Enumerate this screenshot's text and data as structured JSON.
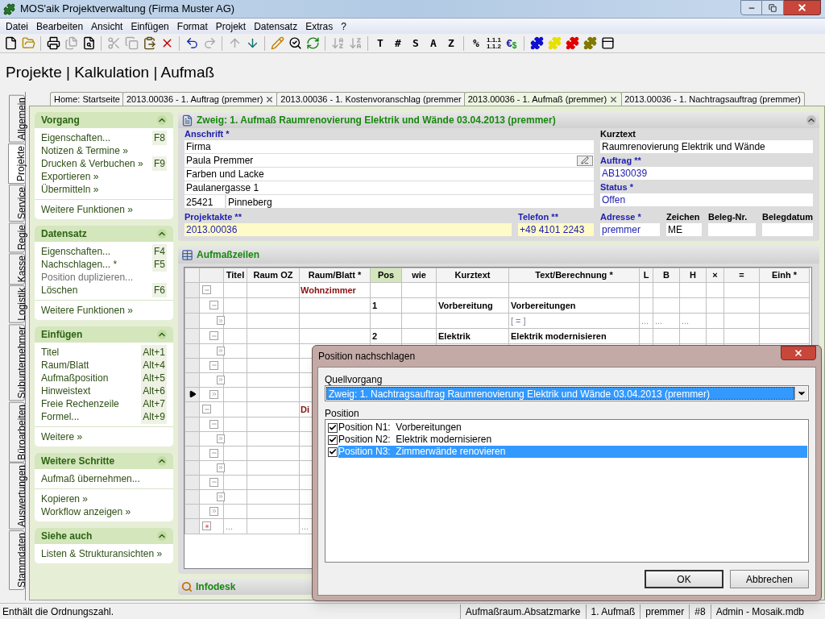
{
  "window": {
    "title": "MOS'aik Projektverwaltung (Firma Muster AG)"
  },
  "menu": [
    "Datei",
    "Bearbeiten",
    "Ansicht",
    "Einfügen",
    "Format",
    "Projekt",
    "Datensatz",
    "Extras",
    "?"
  ],
  "toolbar": [
    {
      "kind": "icon",
      "disabled": false
    },
    {
      "kind": "icon",
      "disabled": false
    },
    {
      "kind": "sep"
    },
    {
      "kind": "icon",
      "disabled": false
    },
    {
      "kind": "icon",
      "disabled": true
    },
    {
      "kind": "icon",
      "disabled": false
    },
    {
      "kind": "sep"
    },
    {
      "kind": "icon",
      "disabled": true
    },
    {
      "kind": "icon",
      "disabled": true
    },
    {
      "kind": "icon",
      "disabled": false
    },
    {
      "kind": "icon",
      "disabled": false
    },
    {
      "kind": "sep"
    },
    {
      "kind": "icon",
      "disabled": false
    },
    {
      "kind": "icon",
      "disabled": true
    },
    {
      "kind": "sep"
    },
    {
      "kind": "icon",
      "disabled": true
    },
    {
      "kind": "icon",
      "disabled": false
    },
    {
      "kind": "sep"
    },
    {
      "kind": "icon",
      "disabled": false
    },
    {
      "kind": "icon",
      "disabled": false
    },
    {
      "kind": "icon",
      "disabled": false
    },
    {
      "kind": "sep"
    },
    {
      "kind": "icon",
      "disabled": true
    },
    {
      "kind": "icon",
      "disabled": true
    },
    {
      "kind": "sep"
    },
    {
      "kind": "text",
      "label": "T",
      "disabled": false
    },
    {
      "kind": "text",
      "label": "#",
      "disabled": false
    },
    {
      "kind": "text",
      "label": "S",
      "disabled": false
    },
    {
      "kind": "text",
      "label": "A",
      "disabled": false
    },
    {
      "kind": "text",
      "label": "Z",
      "disabled": false
    },
    {
      "kind": "sep"
    },
    {
      "kind": "text",
      "label": "%",
      "disabled": false
    },
    {
      "kind": "stack",
      "lines": [
        "1.1.1",
        "1.1.2"
      ],
      "disabled": false
    },
    {
      "kind": "currency",
      "parts": [
        "€",
        "$"
      ],
      "disabled": false
    },
    {
      "kind": "sep"
    },
    {
      "kind": "icon",
      "color": "#1010d0",
      "disabled": false
    },
    {
      "kind": "icon",
      "color": "#e8e000",
      "disabled": false
    },
    {
      "kind": "icon",
      "color": "#e00000",
      "disabled": false
    },
    {
      "kind": "icon",
      "color": "#807800",
      "disabled": false
    },
    {
      "kind": "icon",
      "disabled": false
    }
  ],
  "header": {
    "title": "Projekte | Kalkulation | Aufmaß"
  },
  "side_tabs": [
    {
      "label": "Allgemein",
      "selected": false
    },
    {
      "label": "Projekte",
      "selected": true
    },
    {
      "label": "Service",
      "selected": false
    },
    {
      "label": "Regie",
      "selected": false
    },
    {
      "label": "Kasse",
      "selected": false
    },
    {
      "label": "Logistik",
      "selected": false
    },
    {
      "label": "Subunternehmer",
      "selected": false
    },
    {
      "label": "Büroarbeiten",
      "selected": false
    },
    {
      "label": "Auswertungen",
      "selected": false
    },
    {
      "label": "Stammdaten",
      "selected": false
    }
  ],
  "doc_tabs": [
    {
      "label": "Home: Startseite",
      "selected": false,
      "closable": false
    },
    {
      "label": "2013.00036 - 1. Auftrag (premmer)",
      "selected": false,
      "closable": true
    },
    {
      "label": "2013.00036 - 1. Kostenvoranschlag (premmer",
      "selected": false,
      "closable": false
    },
    {
      "label": "2013.00036 - 1. Aufmaß (premmer)",
      "selected": true,
      "closable": true
    },
    {
      "label": "2013.00036 - 1. Nachtragsauftrag (premmer)",
      "selected": false,
      "closable": false
    }
  ],
  "sidebar": [
    {
      "title": "Vorgang",
      "groups": [
        [
          {
            "label": "Eigenschaften...",
            "shortcut": "F8",
            "disabled": false
          },
          {
            "label": "Notizen & Termine »",
            "disabled": false
          },
          {
            "label": "Drucken & Verbuchen »",
            "shortcut": "F9",
            "disabled": false
          },
          {
            "label": "Exportieren »",
            "disabled": false
          },
          {
            "label": "Übermitteln »",
            "disabled": false
          }
        ],
        [
          {
            "label": "Weitere Funktionen »",
            "disabled": false
          }
        ]
      ]
    },
    {
      "title": "Datensatz",
      "groups": [
        [
          {
            "label": "Eigenschaften...",
            "shortcut": "F4",
            "disabled": false
          },
          {
            "label": "Nachschlagen... *",
            "shortcut": "F5",
            "disabled": false
          },
          {
            "label": "Position duplizieren...",
            "disabled": true
          },
          {
            "label": "Löschen",
            "shortcut": "F6",
            "disabled": false
          }
        ],
        [
          {
            "label": "Weitere Funktionen »",
            "disabled": false
          }
        ]
      ]
    },
    {
      "title": "Einfügen",
      "groups": [
        [
          {
            "label": "Titel",
            "shortcut": "Alt+1",
            "disabled": false
          },
          {
            "label": "Raum/Blatt",
            "shortcut": "Alt+4",
            "disabled": false
          },
          {
            "label": "Aufmaßposition",
            "shortcut": "Alt+5",
            "disabled": false
          },
          {
            "label": "Hinweistext",
            "shortcut": "Alt+6",
            "disabled": false
          },
          {
            "label": "Freie Rechenzeile",
            "shortcut": "Alt+7",
            "disabled": false
          },
          {
            "label": "Formel...",
            "shortcut": "Alt+9",
            "disabled": false
          }
        ],
        [
          {
            "label": "Weitere »",
            "disabled": false
          }
        ]
      ]
    },
    {
      "title": "Weitere Schritte",
      "groups": [
        [
          {
            "label": "Aufmaß übernehmen...",
            "disabled": false
          }
        ],
        [
          {
            "label": "Kopieren »",
            "disabled": false
          },
          {
            "label": "Workflow anzeigen »",
            "disabled": false
          }
        ]
      ]
    },
    {
      "title": "Siehe auch",
      "groups": [
        [
          {
            "label": "Listen & Strukturansichten »",
            "disabled": false
          }
        ]
      ]
    }
  ],
  "record": {
    "title": "Zweig: 1. Aufmaß Raumrenovierung Elektrik und Wände 03.04.2013 (premmer)",
    "anschrift": {
      "label": "Anschrift *",
      "lines": [
        "Firma",
        "Paula Premmer",
        "Farben und Lacke",
        "Paulanergasse 1"
      ],
      "zip": "25421",
      "city": "Pinneberg"
    },
    "right": [
      {
        "label": "Kurztext",
        "value": "Raumrenovierung Elektrik und Wände",
        "linked": false
      },
      {
        "label": "Auftrag **",
        "value": "AB130039",
        "linked": true
      },
      {
        "label": "Status *",
        "value": "Offen",
        "linked": true
      }
    ],
    "projektakte": {
      "label": "Projektakte **",
      "value": "2013.00036",
      "linked": true
    },
    "telefon": {
      "label": "Telefon **",
      "value": "+49 4101 2243",
      "linked": true
    },
    "small": [
      {
        "label": "Adresse *",
        "value": "premmer",
        "linked": true
      },
      {
        "label": "Zeichen",
        "value": "ME",
        "linked": false
      },
      {
        "label": "Beleg-Nr.",
        "linked": false
      },
      {
        "label": "Belegdatum",
        "linked": false
      }
    ]
  },
  "aufmass": {
    "title": "Aufmaßzeilen",
    "columns": [
      {
        "label": "Titel",
        "selected": false
      },
      {
        "label": "Raum OZ",
        "selected": false
      },
      {
        "label": "Raum/Blatt *",
        "selected": false
      },
      {
        "label": "Pos",
        "selected": true
      },
      {
        "label": "wie",
        "selected": false
      },
      {
        "label": "Kurztext",
        "selected": false
      },
      {
        "label": "Text/Berechnung *",
        "selected": false
      },
      {
        "label": "L",
        "selected": false
      },
      {
        "label": "B",
        "selected": false
      },
      {
        "label": "H",
        "selected": false
      },
      {
        "label": "×",
        "selected": false
      },
      {
        "label": "=",
        "selected": false
      },
      {
        "label": "Einh *",
        "selected": false
      }
    ],
    "rows": [
      {
        "kind": "title",
        "current": false,
        "cells": {
          "2": "Wohnzimmer"
        }
      },
      {
        "kind": "position",
        "current": false,
        "cells": {
          "3": "1",
          "5": "Vorbereitung",
          "6": "Vorbereitungen"
        }
      },
      {
        "kind": "calc",
        "current": false,
        "cells": {
          "6": "[ = ]",
          "7": "...",
          "8": "...",
          "9": "..."
        }
      },
      {
        "kind": "position",
        "current": false,
        "cells": {
          "3": "2",
          "5": "Elektrik",
          "6": "Elektrik modernisieren"
        }
      },
      {
        "kind": "calc",
        "current": false,
        "cells": {}
      },
      {
        "kind": "position",
        "current": false,
        "cells": {}
      },
      {
        "kind": "calc",
        "current": false,
        "cells": {}
      },
      {
        "kind": "note",
        "current": true,
        "cells": {}
      },
      {
        "kind": "title",
        "current": false,
        "cells": {
          "2": "Di"
        }
      },
      {
        "kind": "position",
        "current": false,
        "cells": {}
      },
      {
        "kind": "calc",
        "current": false,
        "cells": {}
      },
      {
        "kind": "position",
        "current": false,
        "cells": {}
      },
      {
        "kind": "calc",
        "current": false,
        "cells": {}
      },
      {
        "kind": "position",
        "current": false,
        "cells": {}
      },
      {
        "kind": "calc",
        "current": false,
        "cells": {}
      },
      {
        "kind": "note",
        "current": false,
        "cells": {}
      },
      {
        "kind": "new",
        "current": false,
        "cells": {
          "0": "...",
          "2": "..."
        }
      }
    ]
  },
  "infodesk": {
    "title": "Infodesk"
  },
  "dialog": {
    "title": "Position nachschlagen",
    "source_label": "Quellvorgang",
    "source_value": "Zweig: 1. Nachtragsauftrag Raumrenovierung Elektrik und Wände 03.04.2013 (premmer)",
    "position_label": "Position",
    "positions": [
      {
        "label": "Position N1:  Vorbereitungen",
        "checked": true,
        "selected": false
      },
      {
        "label": "Position N2:  Elektrik modernisieren",
        "checked": true,
        "selected": false
      },
      {
        "label": "Position N3:  Zimmerwände renovieren",
        "checked": true,
        "selected": true
      }
    ],
    "buttons": [
      {
        "label": "OK",
        "default": true
      },
      {
        "label": "Abbrechen",
        "default": false
      }
    ]
  },
  "status_bar": {
    "message": "Enthält die Ordnungszahl.",
    "panels": [
      "Aufmaßraum.Absatzmarke",
      "1. Aufmaß",
      "premmer",
      "#8",
      "Admin - Mosaik.mdb"
    ]
  }
}
